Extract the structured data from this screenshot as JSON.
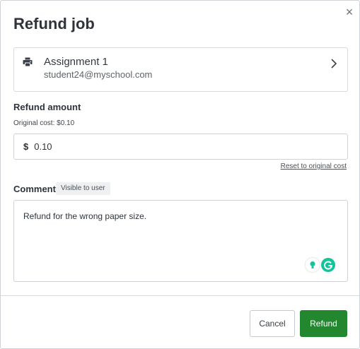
{
  "dialog": {
    "title": "Refund job",
    "close_symbol": "×",
    "close_icon": "close-icon"
  },
  "job": {
    "icon": "printer-icon",
    "name": "Assignment 1",
    "email": "student24@myschool.com",
    "chevron_icon": "chevron-right-icon"
  },
  "refund_amount": {
    "label": "Refund amount",
    "original_cost": "Original cost: $0.10",
    "currency_symbol": "$",
    "value": "0.10",
    "reset_link": "Reset to original cost"
  },
  "comment": {
    "label": "Comment",
    "badge": "Visible to user",
    "value": "Refund for the wrong paper size.",
    "extension_icons": [
      "grammarly-bulb-icon",
      "grammarly-logo-icon"
    ]
  },
  "footer": {
    "cancel_label": "Cancel",
    "refund_label": "Refund"
  },
  "colors": {
    "primary_button": "#22872f",
    "grammarly_green": "#15c39a",
    "border": "#cfd3d7",
    "text": "#2e343a"
  }
}
